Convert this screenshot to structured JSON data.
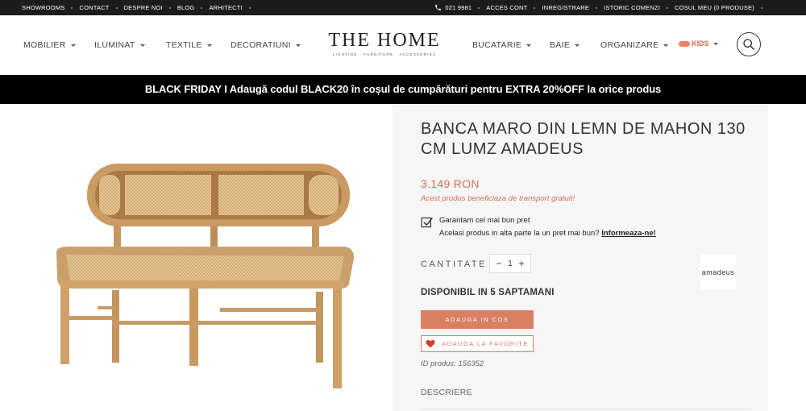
{
  "topbar": {
    "left_links": [
      "SHOWROOMS",
      "CONTACT",
      "DESPRE NOI",
      "BLOG",
      "ARHITECTI"
    ],
    "phone": "021 9981",
    "right_links": [
      "ACCES CONT",
      "INREGISTRARE",
      "ISTORIC COMENZI",
      "COSUL MEU (0 PRODUSE)"
    ]
  },
  "header": {
    "nav_left": [
      "MOBILIER",
      "ILUMINAT",
      "TEXTILE",
      "DECORATIUNI"
    ],
    "nav_right": [
      "BUCATARIE",
      "BAIE",
      "ORGANIZARE"
    ],
    "kids_label": "KIDS",
    "logo": {
      "title": "THE HOME",
      "tagline": "LIGHTING · FURNITURE · ACCESSORIES"
    }
  },
  "banner": {
    "text": "BLACK FRIDAY I Adaugă codul BLACK20 în coșul de cumpărături pentru EXTRA 20%OFF la orice produs"
  },
  "product": {
    "title": "BANCA MARO DIN LEMN DE MAHON 130 CM LUMZ AMADEUS",
    "price": "3.149 RON",
    "free_shipping": "Acest produs beneficiaza de transport gratuit!",
    "guarantee_title": "Garantam cel mai bun pret",
    "guarantee_text": "Acelasi produs in alta parte la un pret mai bun?",
    "guarantee_link": "Informeaza-ne!",
    "quantity_label": "CANTITATE",
    "quantity_value": "1",
    "brand": "amadeus",
    "availability": "DISPONIBIL IN 5 SAPTAMANI",
    "add_to_cart": "ADAUGA IN COS",
    "add_to_favorites": "ADAUGA LA FAVORITE",
    "id_label": "ID produs:",
    "id_value": "156352",
    "description_tab": "DESCRIERE"
  },
  "colors": {
    "accent": "#d97f63",
    "topbar_bg": "#1c1c1c",
    "banner_bg": "#000000",
    "panel_bg": "#f6f6f6",
    "wood": "#c99a62",
    "rattan": "#e2c08e"
  }
}
